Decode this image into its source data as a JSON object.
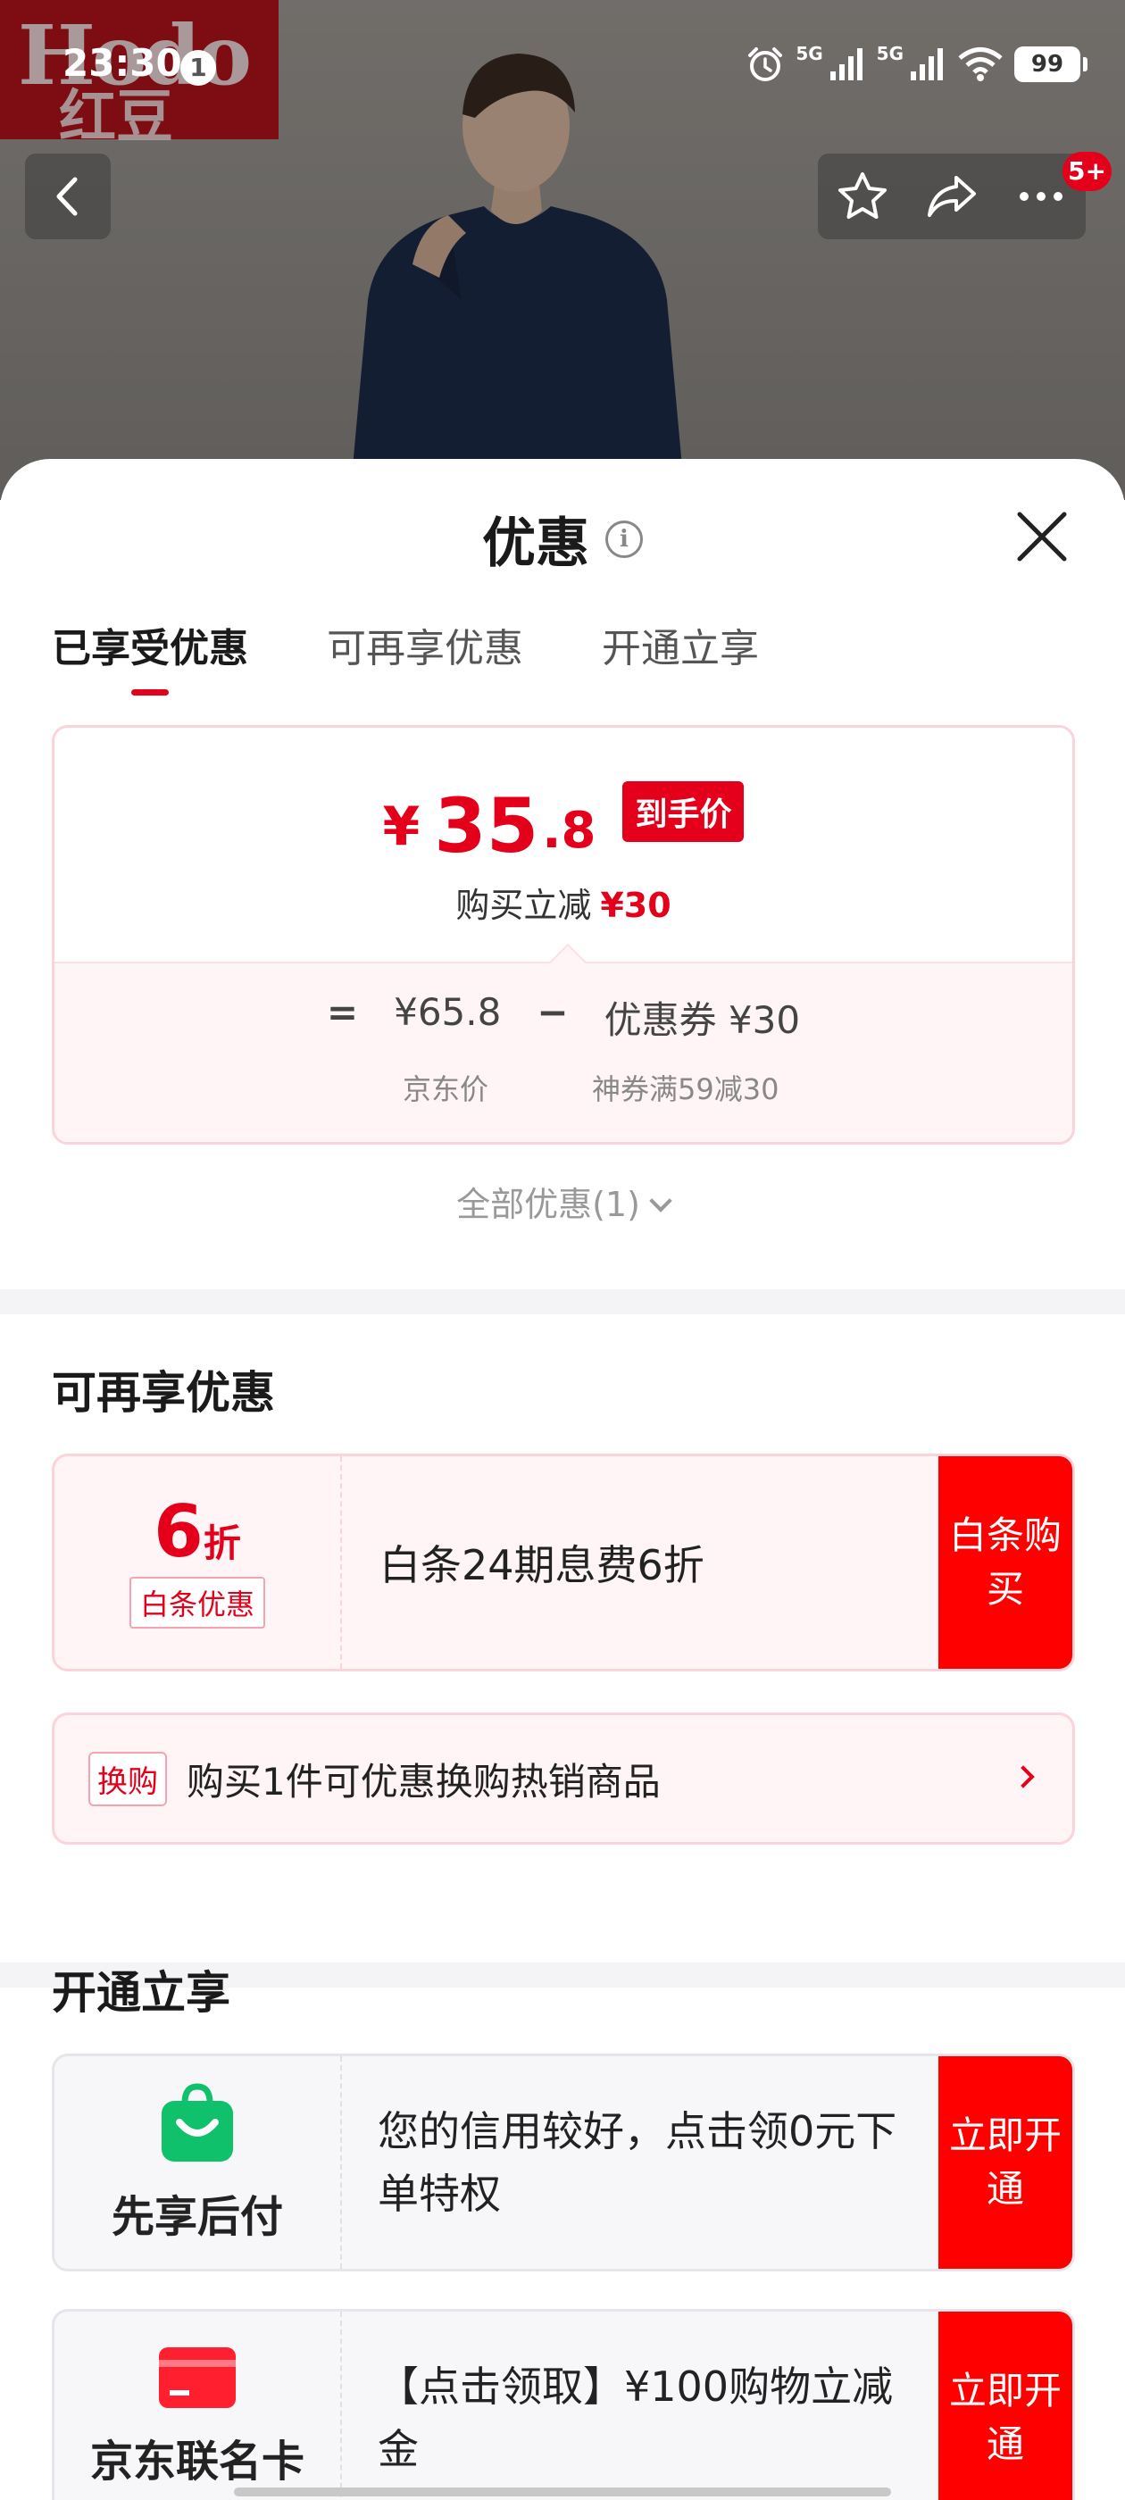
{
  "status_bar": {
    "time": "23:30",
    "notification_count": "1",
    "network_1": "5G",
    "network_2": "5G",
    "battery": "99"
  },
  "hero": {
    "brand_logo_latin": "Hodo",
    "brand_logo_cn": "红豆",
    "cart_badge": "5+"
  },
  "sheet": {
    "title": "优惠",
    "tabs": [
      "已享受优惠",
      "可再享优惠",
      "开通立享"
    ],
    "price_card": {
      "currency": "¥",
      "price_int": "35",
      "price_dec": ".8",
      "price_tag": "到手价",
      "reduce_label": "购买立减",
      "reduce_amount": "¥30",
      "equals": "=",
      "jd_price": "¥65.8",
      "minus": "−",
      "coupon": "优惠券 ¥30",
      "jd_price_label": "京东价",
      "coupon_label": "神券满59减30"
    },
    "all_offers": "全部优惠(1)"
  },
  "reenjoy": {
    "title": "可再享优惠",
    "baitiao": {
      "discount_num": "6",
      "discount_unit": "折",
      "tag": "白条优惠",
      "description": "白条24期息费6折",
      "button": "白条购买"
    },
    "swap": {
      "tag": "换购",
      "text": "购买1件可优惠换购热销商品"
    }
  },
  "open_enjoy": {
    "title": "开通立享",
    "items": [
      {
        "name": "先享后付",
        "description": "您的信用较好，点击领0元下单特权",
        "button": "立即开通"
      },
      {
        "name": "京东联名卡",
        "description": "【点击领取】¥100购物立减金",
        "button": "立即开通"
      }
    ]
  },
  "colors": {
    "accent_red": "#e4001b",
    "button_red": "#ff0000",
    "card_pink_bg": "#fff5f6",
    "green_icon": "#0fc16b"
  }
}
